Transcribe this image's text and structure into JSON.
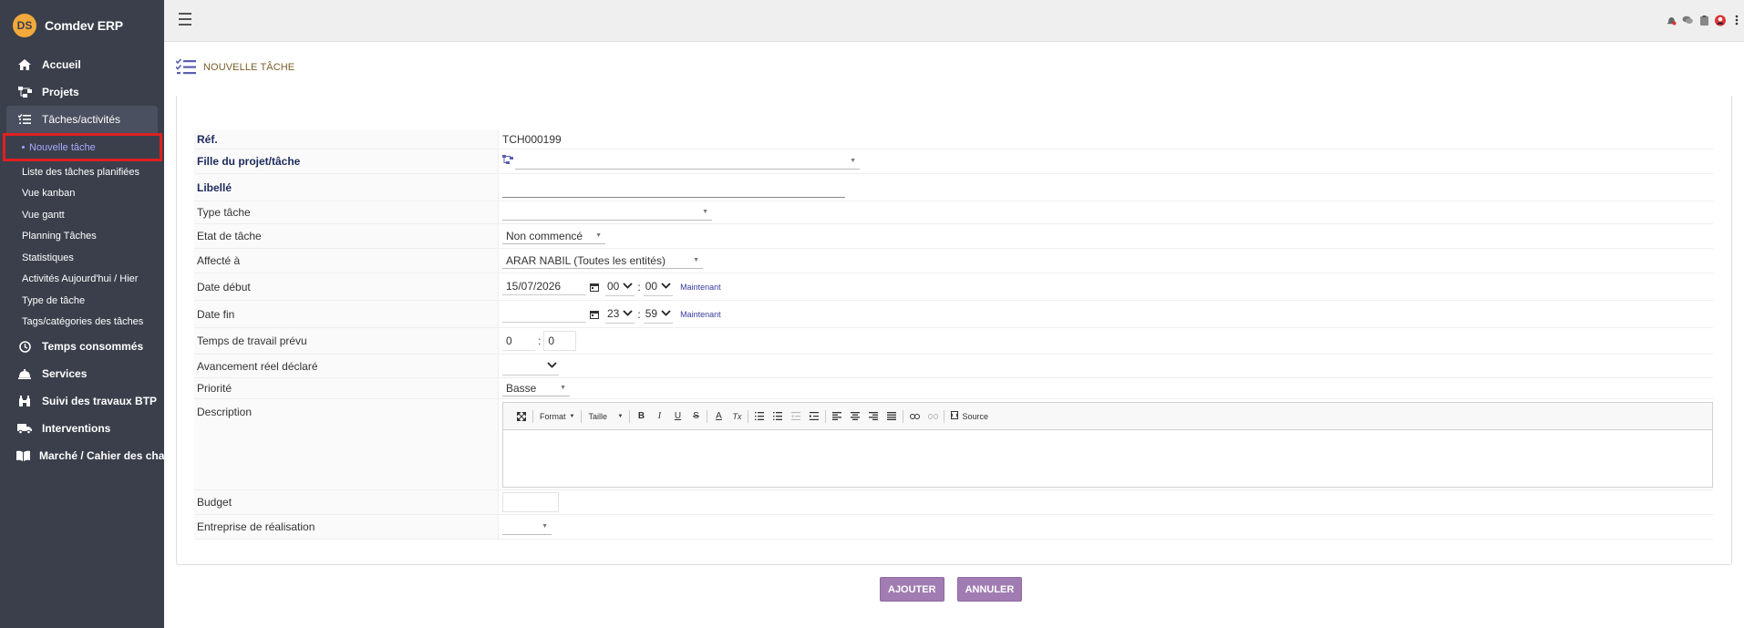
{
  "app": {
    "name": "Comdev ERP",
    "logo_text": "DS"
  },
  "sidebar": {
    "items": [
      {
        "label": "Accueil"
      },
      {
        "label": "Projets"
      },
      {
        "label": "Tâches/activités"
      },
      {
        "label": "Temps consommés"
      },
      {
        "label": "Services"
      },
      {
        "label": "Suivi des travaux BTP"
      },
      {
        "label": "Interventions"
      },
      {
        "label": "Marché / Cahier des charg"
      }
    ],
    "subitems": [
      {
        "label": "Nouvelle tâche"
      },
      {
        "label": "Liste des tâches planifiées"
      },
      {
        "label": "Vue kanban"
      },
      {
        "label": "Vue gantt"
      },
      {
        "label": "Planning Tâches"
      },
      {
        "label": "Statistiques"
      },
      {
        "label": "Activités Aujourd'hui / Hier"
      },
      {
        "label": "Type de tâche"
      },
      {
        "label": "Tags/catégories des tâches"
      }
    ]
  },
  "page": {
    "title": "NOUVELLE TÂCHE"
  },
  "form": {
    "ref": {
      "label": "Réf.",
      "value": "TCH000199"
    },
    "parent": {
      "label": "Fille du projet/tâche",
      "value": ""
    },
    "libelle": {
      "label": "Libellé",
      "value": ""
    },
    "type": {
      "label": "Type tâche",
      "value": ""
    },
    "etat": {
      "label": "Etat de tâche",
      "value": "Non commencé"
    },
    "affecte": {
      "label": "Affecté à",
      "value": "ARAR NABIL (Toutes les entités)"
    },
    "date_debut": {
      "label": "Date début",
      "date": "15/07/2026",
      "hour": "00",
      "minute": "00",
      "now": "Maintenant"
    },
    "date_fin": {
      "label": "Date fin",
      "date": "",
      "hour": "23",
      "minute": "59",
      "now": "Maintenant"
    },
    "temps": {
      "label": "Temps de travail prévu",
      "hours": "0",
      "minutes": "0"
    },
    "avancement": {
      "label": "Avancement réel déclaré",
      "value": ""
    },
    "priorite": {
      "label": "Priorité",
      "value": "Basse"
    },
    "description": {
      "label": "Description",
      "value": ""
    },
    "budget": {
      "label": "Budget",
      "value": ""
    },
    "entreprise": {
      "label": "Entreprise de réalisation",
      "value": ""
    }
  },
  "editor": {
    "format_label": "Format",
    "size_label": "Taille",
    "source_label": "Source",
    "bold": "B",
    "italic": "I",
    "underline": "U",
    "strike": "S",
    "textcolor": "A",
    "clear": "Tx"
  },
  "actions": {
    "add": "AJOUTER",
    "cancel": "ANNULER"
  },
  "colors": {
    "sidebar_bg": "#3a3f4b",
    "accent": "#a07cb2",
    "highlight": "#e02020",
    "link": "#3a3aa0"
  }
}
